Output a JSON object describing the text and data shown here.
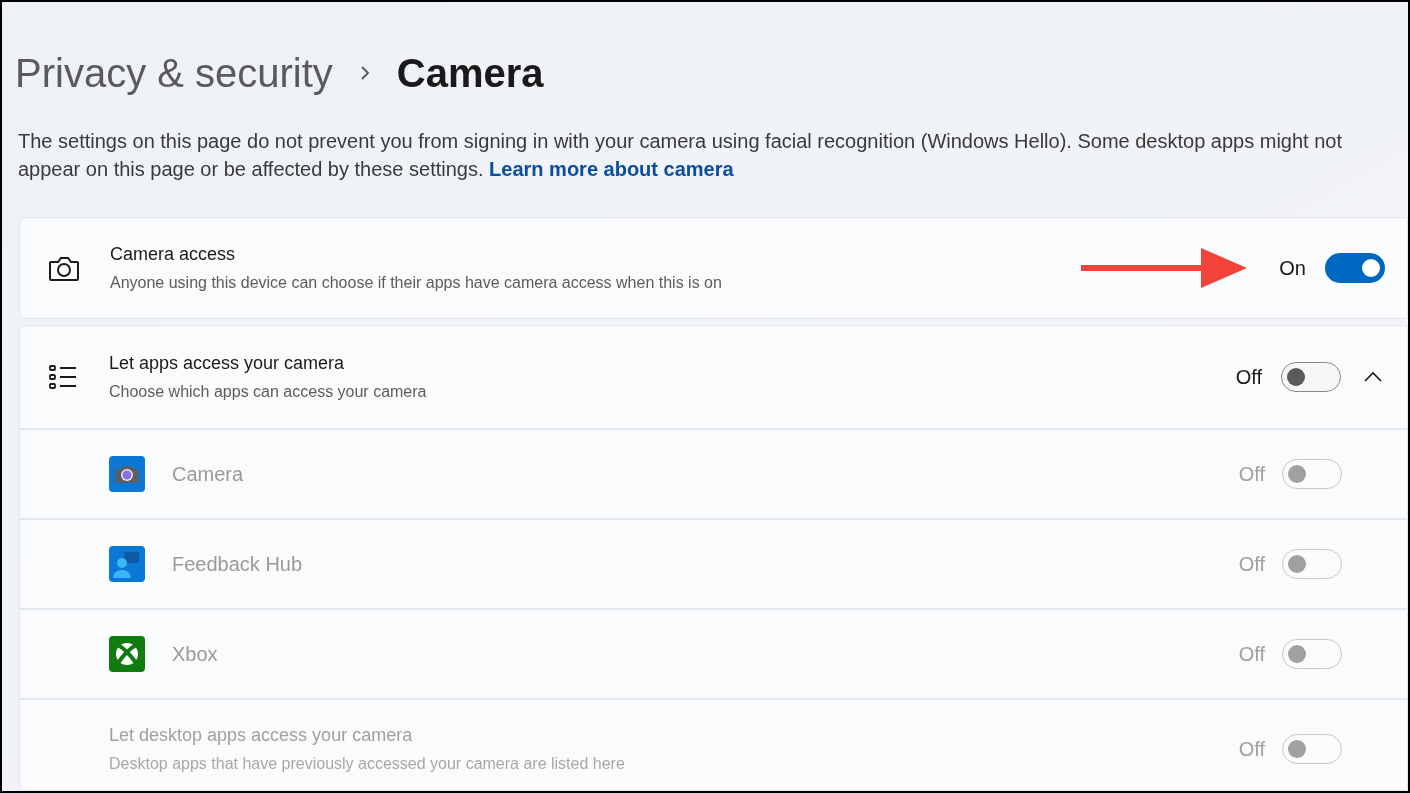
{
  "breadcrumb": {
    "parent": "Privacy & security",
    "current": "Camera"
  },
  "description": {
    "text": "The settings on this page do not prevent you from signing in with your camera using facial recognition (Windows Hello). Some desktop apps might not appear on this page or be affected by these settings.",
    "link": "Learn more about camera"
  },
  "camera_access": {
    "title": "Camera access",
    "subtitle": "Anyone using this device can choose if their apps have camera access when this is on",
    "state_label": "On",
    "on": true
  },
  "app_access": {
    "title": "Let apps access your camera",
    "subtitle": "Choose which apps can access your camera",
    "state_label": "Off",
    "on": false,
    "expanded": true,
    "apps": [
      {
        "name": "Camera",
        "kind": "camera",
        "state_label": "Off",
        "on": false,
        "disabled": true
      },
      {
        "name": "Feedback Hub",
        "kind": "feedback",
        "state_label": "Off",
        "on": false,
        "disabled": true
      },
      {
        "name": "Xbox",
        "kind": "xbox",
        "state_label": "Off",
        "on": false,
        "disabled": true
      }
    ]
  },
  "desktop_apps": {
    "title": "Let desktop apps access your camera",
    "subtitle": "Desktop apps that have previously accessed your camera are listed here",
    "state_label": "Off",
    "on": false,
    "disabled": true
  }
}
